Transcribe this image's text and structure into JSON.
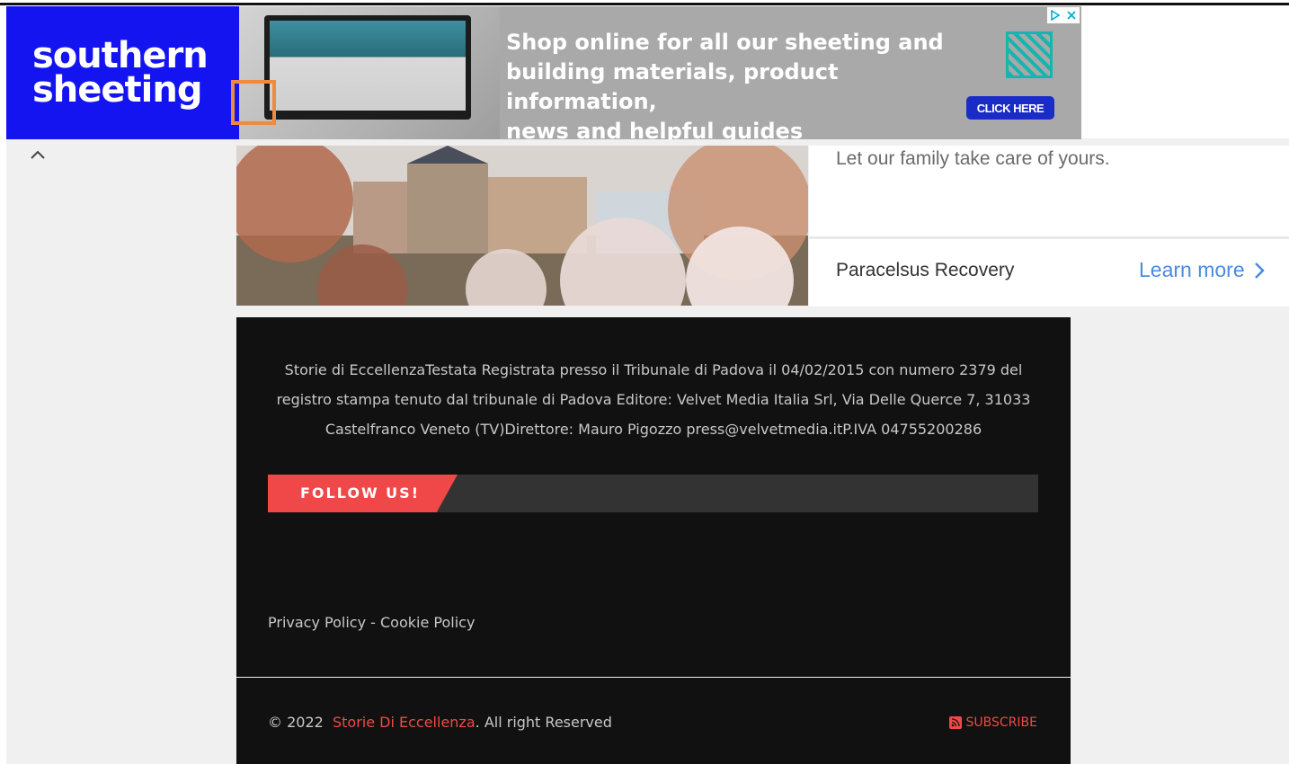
{
  "ad_banner": {
    "logo_line1": "southern",
    "logo_line2": "sheeting",
    "text_line1": "Shop online for all our sheeting and",
    "text_line2": "building materials, product information,",
    "text_line3": "news and helpful guides",
    "cta": "CLICK HERE",
    "adchoices_icon": "adchoices-icon",
    "close_icon": "close-icon"
  },
  "scroll_up_icon": "chevron-up-icon",
  "native_ad": {
    "tagline": "Let our family take care of yours.",
    "brand": "Paracelsus Recovery",
    "learn_more": "Learn more"
  },
  "footer": {
    "about": "Storie di EccellenzaTestata Registrata presso il Tribunale di Padova il 04/02/2015 con numero 2379 del registro stampa tenuto dal tribunale di Padova Editore: Velvet Media Italia Srl, Via Delle Querce 7, 31033 Castelfranco Veneto (TV)Direttore: Mauro Pigozzo press@velvetmedia.itP.IVA 04755200286",
    "follow_us": "FOLLOW US!",
    "privacy_policy": "Privacy Policy",
    "link_separator": " - ",
    "cookie_policy": "Cookie Policy",
    "copyright_prefix": "© 2022",
    "site_name": "Storie Di Eccellenza",
    "copyright_suffix": ". All right Reserved",
    "subscribe": "SUBSCRIBE"
  },
  "colors": {
    "accent": "#f04848",
    "footer_bg": "#111111",
    "ad_blue": "#1414f0",
    "learn_more": "#4a8be0"
  }
}
